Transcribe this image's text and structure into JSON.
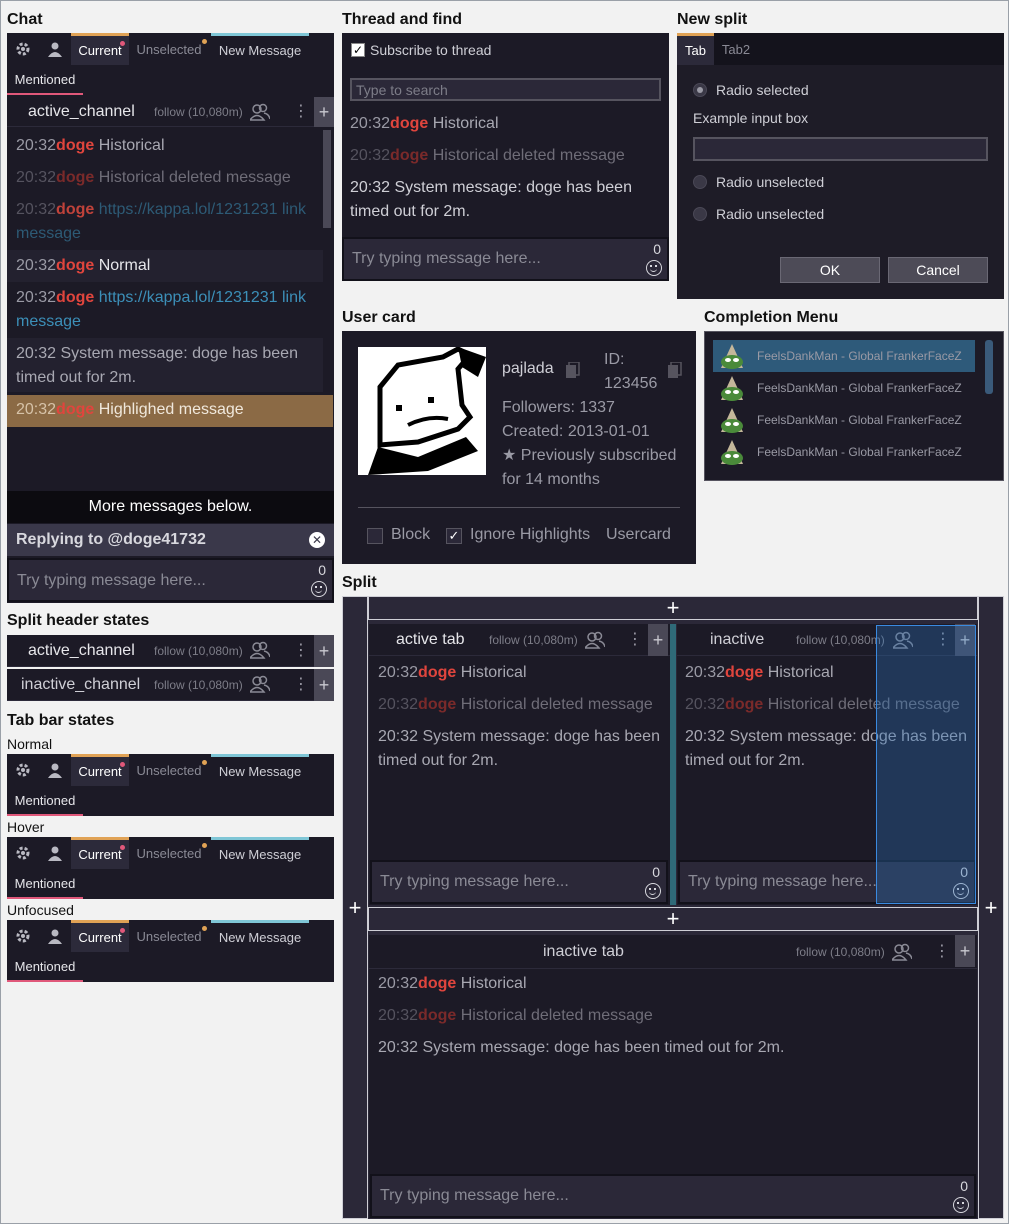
{
  "sections": {
    "chat": "Chat",
    "thread": "Thread and find",
    "new_split": "New split",
    "user_card": "User card",
    "completion": "Completion Menu",
    "split": "Split",
    "split_header_states": "Split header states",
    "tab_bar_states": "Tab bar states"
  },
  "tabs": {
    "current": "Current",
    "unselected": "Unselected",
    "new_message": "New Message",
    "mentioned": "Mentioned"
  },
  "tab_bar_state_labels": [
    "Normal",
    "Hover",
    "Unfocused"
  ],
  "colors": {
    "background_dark": "#1c1a26",
    "username": "#e0453d",
    "link": "#3c8fb8",
    "highlight": "#8b6a45",
    "current_tab_accent": "#e0a255",
    "new_message_accent": "#7fc6d6",
    "mention_accent": "#e0587a",
    "selection_overlay": "#2a6fb8"
  },
  "header": {
    "active_channel": "active_channel",
    "inactive_channel": "inactive_channel",
    "follow": "follow (10,080m)"
  },
  "messages": {
    "time": "20:32",
    "user": "doge",
    "historical": "Historical",
    "deleted": "Historical deleted message",
    "link_url": "https://kappa.lol/1231231",
    "link_tail": "link",
    "link_word": "message",
    "normal": "Normal",
    "system": "20:32 System message: doge has been timed out for 2m.",
    "system_line1": "20:32 System message: doge has been",
    "system_line2": "timed out for 2m.",
    "highlighted": "Highlighed message",
    "more_below": "More messages below."
  },
  "reply": {
    "label": "Replying to @doge41732"
  },
  "input": {
    "placeholder": "Try typing message here...",
    "count": "0"
  },
  "thread": {
    "subscribe": "Subscribe to thread",
    "search_placeholder": "Type to search"
  },
  "new_split": {
    "tab1": "Tab",
    "tab2": "Tab2",
    "radio_selected": "Radio selected",
    "input_label": "Example input box",
    "radio_unselected": "Radio unselected",
    "ok": "OK",
    "cancel": "Cancel"
  },
  "user_card": {
    "name": "pajlada",
    "id_label": "ID:",
    "id_value": "123456",
    "followers": "Followers: 1337",
    "created": "Created: 2013-01-01",
    "sub_line1": "★ Previously subscribed",
    "sub_line2": "for 14 months",
    "block": "Block",
    "ignore_highlights": "Ignore Highlights",
    "usercard": "Usercard"
  },
  "completion": {
    "items": [
      "FeelsDankMan - Global FrankerFaceZ",
      "FeelsDankMan - Global FrankerFaceZ",
      "FeelsDankMan - Global FrankerFaceZ",
      "FeelsDankMan - Global FrankerFaceZ"
    ]
  },
  "split": {
    "active_tab": "active tab",
    "inactive": "inactive",
    "inactive_tab": "inactive tab",
    "plus": "+"
  }
}
